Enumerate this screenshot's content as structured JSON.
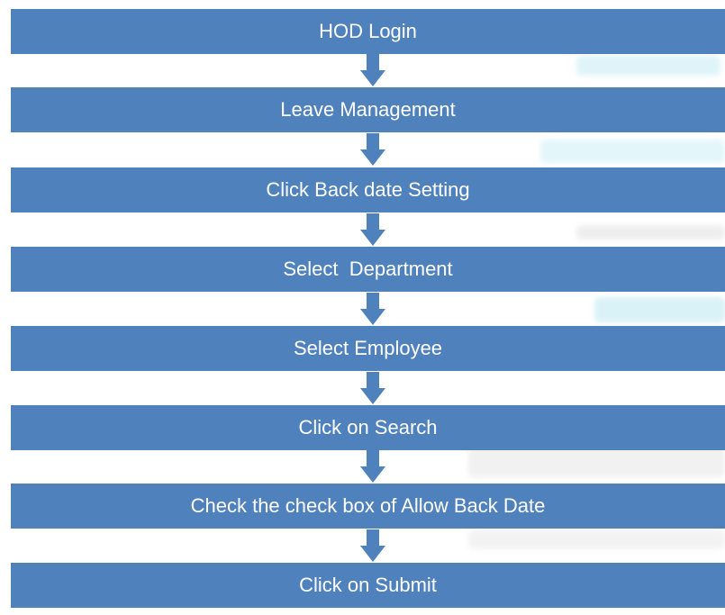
{
  "flowchart": {
    "steps": [
      "HOD Login",
      "Leave Management",
      "Click Back date Setting",
      "Select  Department",
      "Select Employee",
      "Click on Search",
      "Check the check box of Allow Back Date",
      "Click on Submit"
    ]
  },
  "colors": {
    "box_fill": "#4f81bd",
    "arrow_fill": "#4f81bd",
    "text": "#ffffff"
  },
  "icons": {
    "connector": "down-arrow-icon"
  }
}
